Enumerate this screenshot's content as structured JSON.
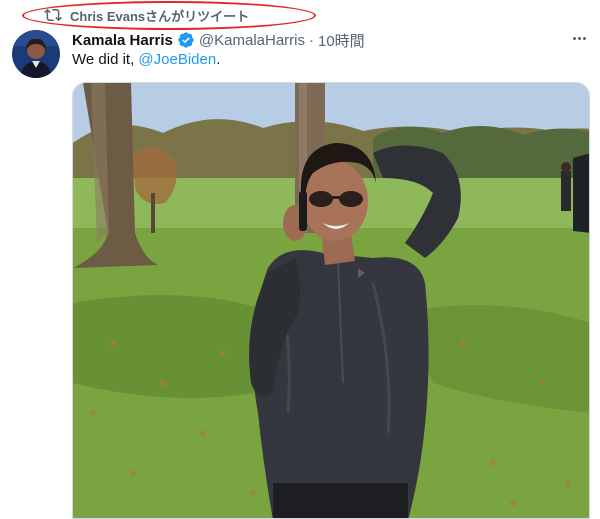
{
  "retweet": {
    "icon": "retweet-icon",
    "user": "Chris Evans",
    "suffix": "さんがリツイート"
  },
  "tweet": {
    "author_name": "Kamala Harris",
    "verified_icon": "verified-badge-icon",
    "handle": "@KamalaHarris",
    "separator": "·",
    "time": "10時間",
    "text_prefix": "We did it, ",
    "mention": "@JoeBiden",
    "text_suffix": ".",
    "more_icon": "more-options-icon",
    "media_icon": "video-icon"
  },
  "colors": {
    "highlight": "#e3262a",
    "link": "#1d9bf0",
    "verified": "#1d9bf0",
    "secondary_text": "#536471"
  }
}
